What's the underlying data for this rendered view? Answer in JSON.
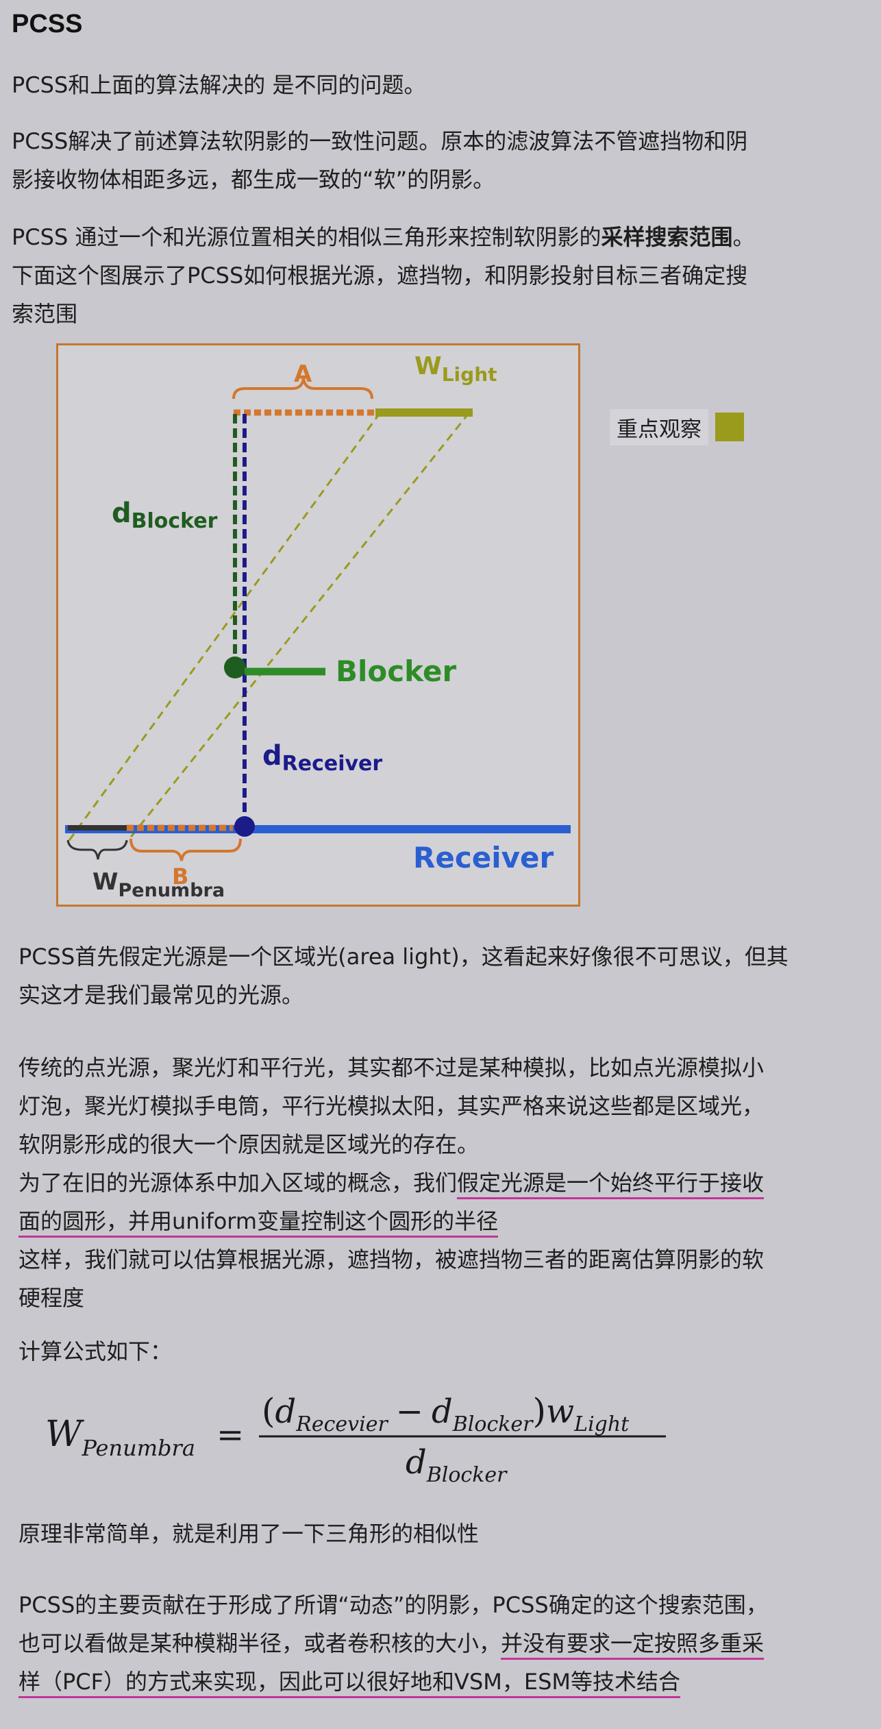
{
  "heading": "PCSS",
  "intro": "PCSS和上面的算法解决的 是不同的问题。",
  "para1": {
    "line1": "PCSS解决了前述算法软阴影的一致性问题。原本的滤波算法不管遮挡物和阴",
    "line2": "影接收物体相距多远，都生成一致的“软”的阴影。"
  },
  "para2": {
    "line1_prefix": "PCSS 通过一个和光源位置相关的相似三角形来控制软阴影的",
    "line1_bold": "采样搜索范围",
    "line1_suffix": "。",
    "line2": "下面这个图展示了PCSS如何根据光源，遮挡物，和阴影投射目标三者确定搜",
    "line3": "索范围"
  },
  "figure": {
    "label_a": "A",
    "label_w": "W",
    "label_w_sub": "Light",
    "label_d": "d",
    "label_d_blocker_sub": "Blocker",
    "label_blocker": "Blocker",
    "label_d_receiver_sub": "Receiver",
    "label_receiver": "Receiver",
    "label_b": "B",
    "label_wp": "W",
    "label_wp_sub": "Penumbra",
    "colors": {
      "orange": "#d4772d",
      "olive": "#9a9a1c",
      "green": "#2d8c26",
      "dark_green": "#1f5c1f",
      "navy": "#1b1b8a",
      "blue": "#2a5fd1"
    }
  },
  "side_note": {
    "text": "重点观察",
    "swatch_color": "#9a9a1c"
  },
  "para3": {
    "line1": "PCSS首先假定光源是一个区域光(area light)，这看起来好像很不可思议，但其",
    "line2": "实这才是我们最常见的光源。"
  },
  "para4": {
    "line1": "传统的点光源，聚光灯和平行光，其实都不过是某种模拟，比如点光源模拟小",
    "line2": "灯泡，聚光灯模拟手电筒，平行光模拟太阳，其实严格来说这些都是区域光，",
    "line3": "软阴影形成的很大一个原因就是区域光的存在。",
    "line4_prefix": "为了在旧的光源体系中加入区域的概念，我们",
    "line4_underlined": "假定光源是一个始终平行于接收",
    "line5_underlined": "面的圆形，并用uniform变量控制这个圆形的半径",
    "line6": "这样，我们就可以估算根据光源，遮挡物，被遮挡物三者的距离估算阴影的软",
    "line7": "硬程度"
  },
  "formula_intro": "计算公式如下：",
  "formula": {
    "lhs_main": "W",
    "lhs_sub": "Penumbra",
    "equals": "=",
    "num_open": "(",
    "num_d1": "d",
    "num_d1_sub": "Recevier",
    "minus": "−",
    "num_d2": "d",
    "num_d2_sub": "Blocker",
    "num_close": ")",
    "num_w": "w",
    "num_w_sub": "Light",
    "den_d": "d",
    "den_sub": "Blocker"
  },
  "para5": "原理非常简单，就是利用了一下三角形的相似性",
  "para6": {
    "line1": "PCSS的主要贡献在于形成了所谓“动态”的阴影，PCSS确定的这个搜索范围，",
    "line2_prefix": "也可以看做是某种模糊半径，或者卷积核的大小，",
    "line2_underlined": "并没有要求一定按照多重采",
    "line3_underlined": "样（PCF）的方式来实现，因此可以很好地和VSM，ESM等技术结合"
  }
}
